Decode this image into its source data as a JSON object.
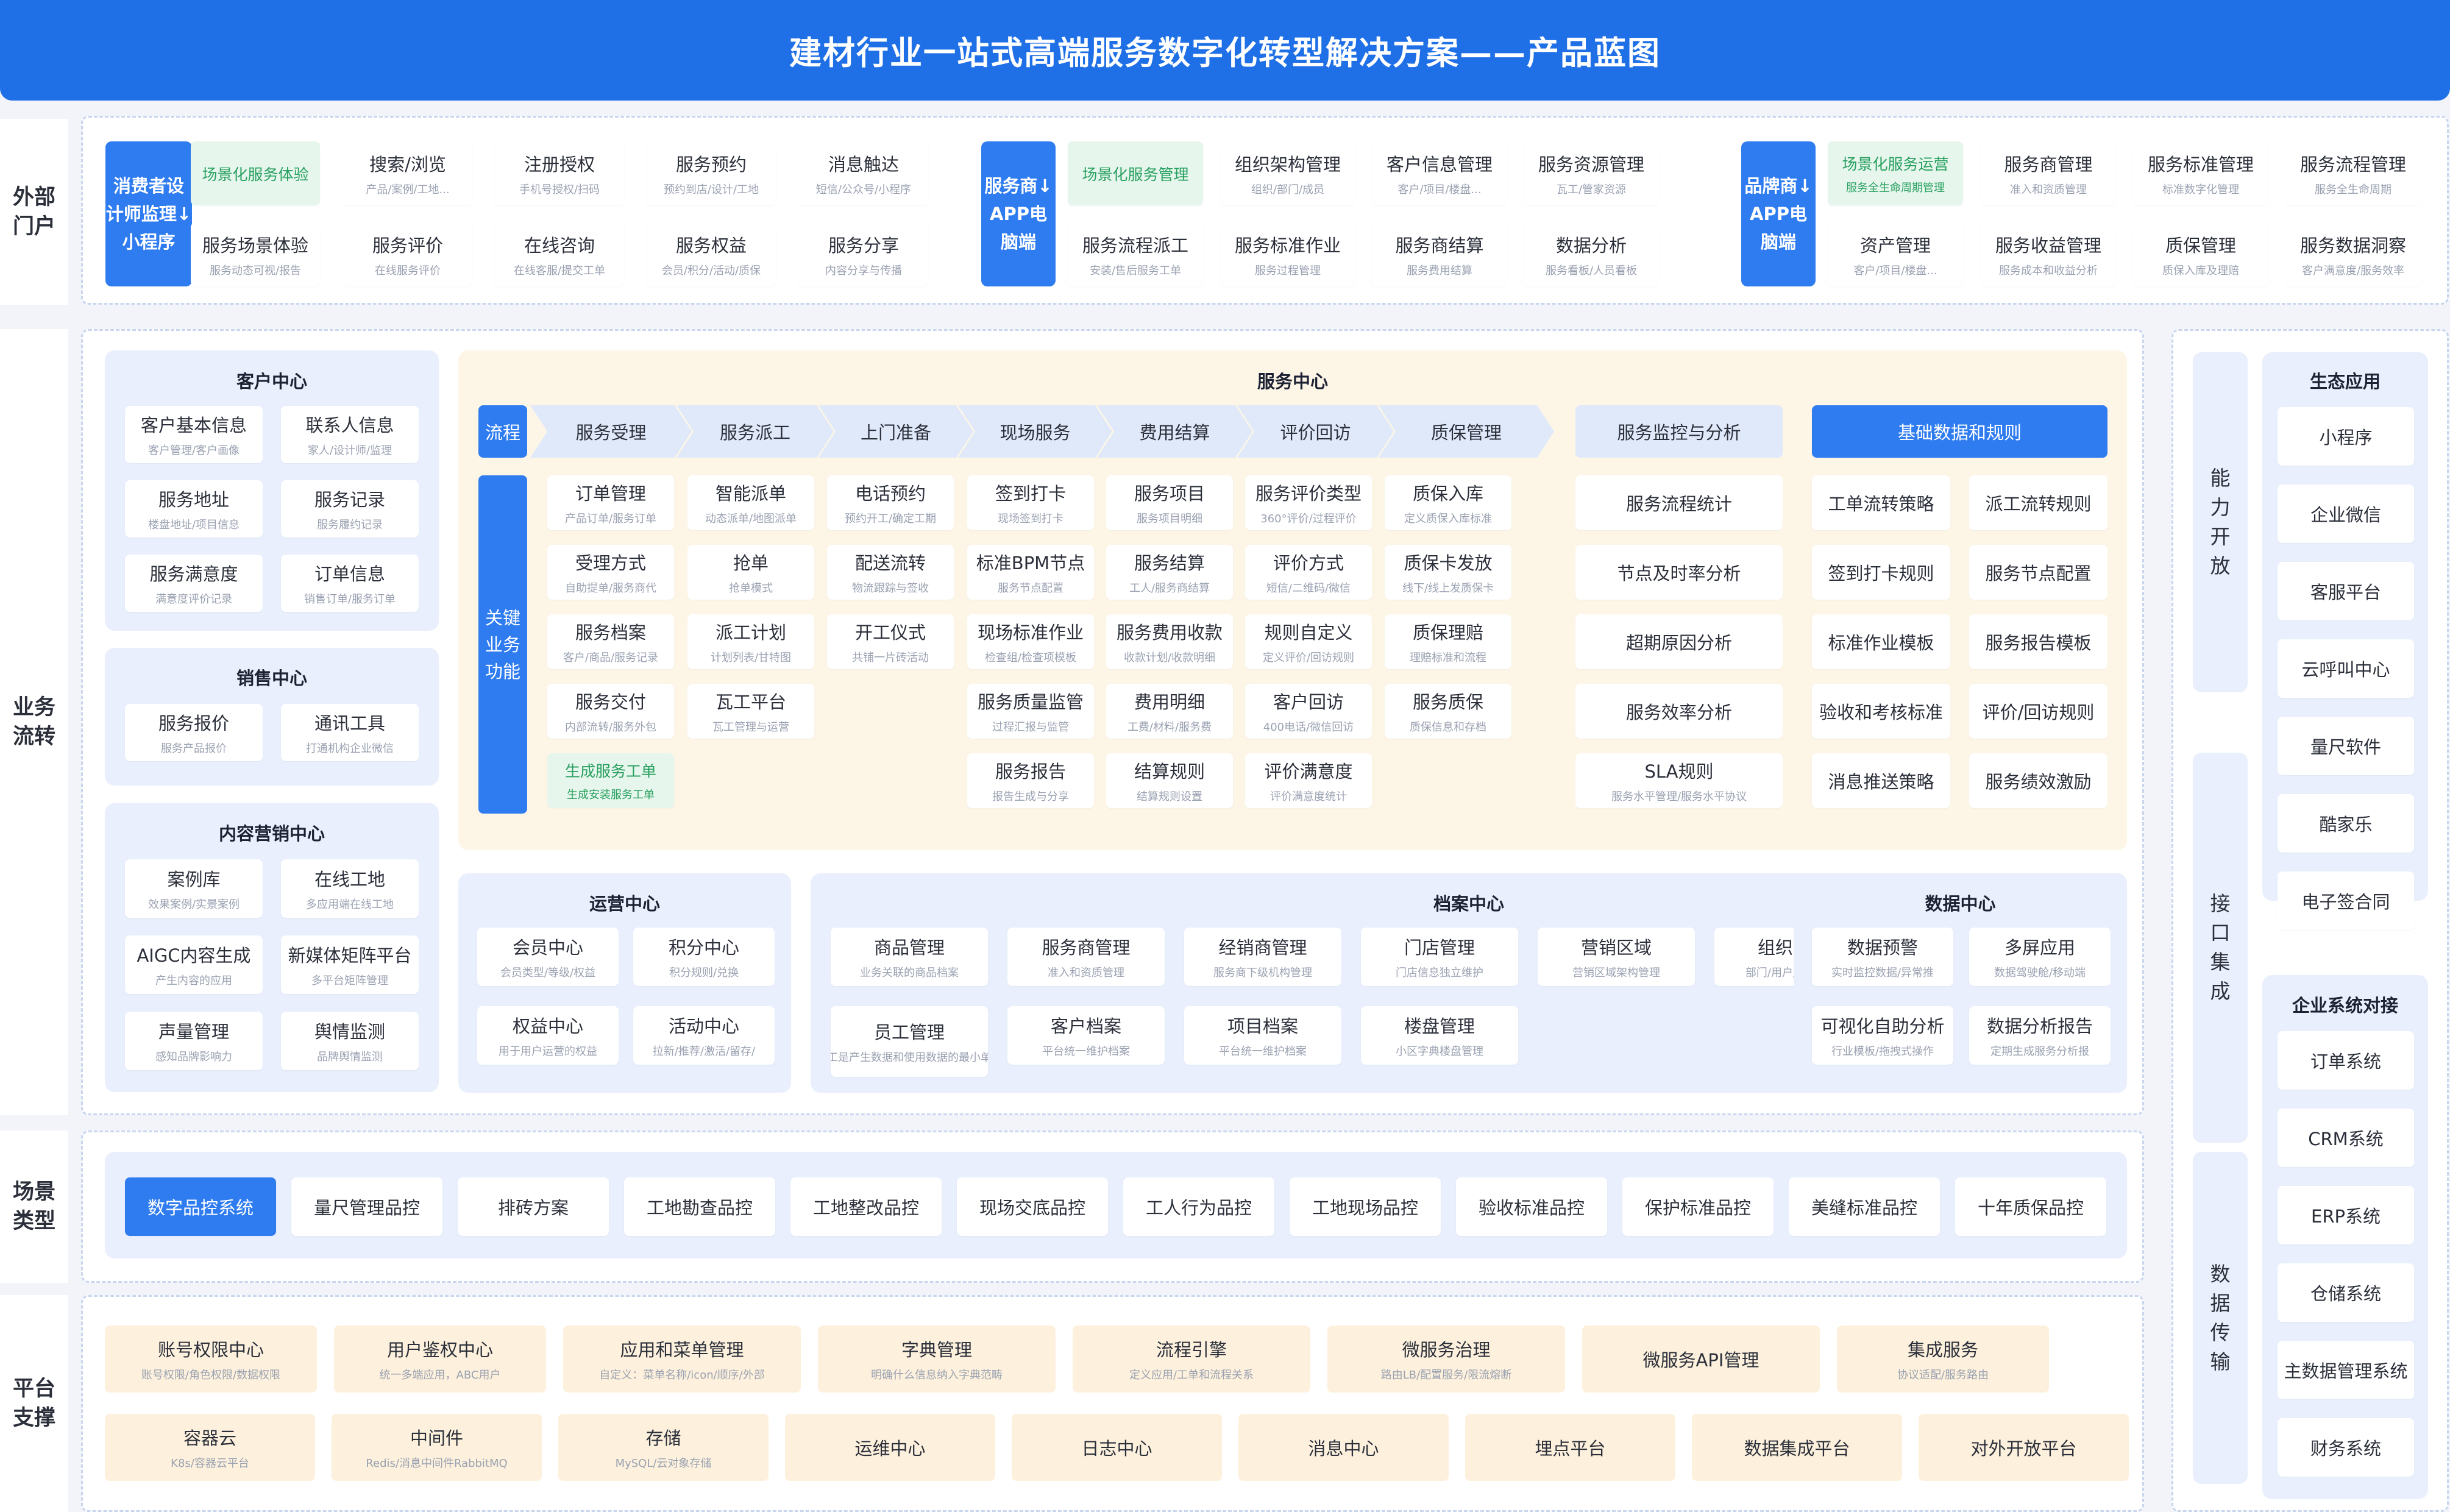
{
  "title": "建材行业一站式高端服务数字化转型解决方案——产品蓝图",
  "rows": {
    "external": "外部门户",
    "business": "业务流转",
    "scene": "场景类型",
    "platform": "平台支撑"
  },
  "portal": {
    "consumer_tag": "消费者设计师监理↓小程序",
    "consumer": [
      {
        "m": "场景化服务体验",
        "s": ""
      },
      {
        "m": "搜索/浏览",
        "s": "产品/案例/工地..."
      },
      {
        "m": "注册授权",
        "s": "手机号授权/扫码"
      },
      {
        "m": "服务预约",
        "s": "预约到店/设计/工地"
      },
      {
        "m": "消息触达",
        "s": "短信/公众号/小程序"
      },
      {
        "m": "服务场景体验",
        "s": "服务动态可视/报告"
      },
      {
        "m": "服务评价",
        "s": "在线服务评价"
      },
      {
        "m": "在线咨询",
        "s": "在线客服/提交工单"
      },
      {
        "m": "服务权益",
        "s": "会员/积分/活动/质保"
      },
      {
        "m": "服务分享",
        "s": "内容分享与传播"
      }
    ],
    "provider_tag": "服务商↓APP电脑端",
    "provider": [
      {
        "m": "场景化服务管理",
        "s": ""
      },
      {
        "m": "组织架构管理",
        "s": "组织/部门/成员"
      },
      {
        "m": "客户信息管理",
        "s": "客户/项目/楼盘..."
      },
      {
        "m": "服务资源管理",
        "s": "瓦工/管家资源"
      },
      {
        "m": "服务流程派工",
        "s": "安装/售后服务工单"
      },
      {
        "m": "服务标准作业",
        "s": "服务过程管理"
      },
      {
        "m": "服务商结算",
        "s": "服务费用结算"
      },
      {
        "m": "数据分析",
        "s": "服务看板/人员看板"
      }
    ],
    "brand_tag": "品牌商↓APP电脑端",
    "brand": [
      {
        "m": "场景化服务运营",
        "s": "服务全生命周期管理"
      },
      {
        "m": "服务商管理",
        "s": "准入和资质管理"
      },
      {
        "m": "服务标准管理",
        "s": "标准数字化管理"
      },
      {
        "m": "服务流程管理",
        "s": "服务全生命周期"
      },
      {
        "m": "资产管理",
        "s": "客户/项目/楼盘..."
      },
      {
        "m": "服务收益管理",
        "s": "服务成本和收益分析"
      },
      {
        "m": "质保管理",
        "s": "质保入库及理赔"
      },
      {
        "m": "服务数据洞察",
        "s": "客户满意度/服务效率"
      }
    ]
  },
  "customer_center": {
    "title": "客户中心",
    "items": [
      {
        "m": "客户基本信息",
        "s": "客户管理/客户画像"
      },
      {
        "m": "联系人信息",
        "s": "家人/设计师/监理"
      },
      {
        "m": "服务地址",
        "s": "楼盘地址/项目信息"
      },
      {
        "m": "服务记录",
        "s": "服务履约记录"
      },
      {
        "m": "服务满意度",
        "s": "满意度评价记录"
      },
      {
        "m": "订单信息",
        "s": "销售订单/服务订单"
      }
    ]
  },
  "sales_center": {
    "title": "销售中心",
    "items": [
      {
        "m": "服务报价",
        "s": "服务产品报价"
      },
      {
        "m": "通讯工具",
        "s": "打通机构企业微信"
      }
    ]
  },
  "content_center": {
    "title": "内容营销中心",
    "items": [
      {
        "m": "案例库",
        "s": "效果案例/实景案例"
      },
      {
        "m": "在线工地",
        "s": "多应用端在线工地"
      },
      {
        "m": "AIGC内容生成",
        "s": "产生内容的应用"
      },
      {
        "m": "新媒体矩阵平台",
        "s": "多平台矩阵管理"
      },
      {
        "m": "声量管理",
        "s": "感知品牌影响力"
      },
      {
        "m": "舆情监测",
        "s": "品牌舆情监测"
      }
    ]
  },
  "service_center": {
    "title": "服务中心",
    "flow_label": "流程",
    "key_label": "关键业务功能",
    "steps": [
      "服务受理",
      "服务派工",
      "上门准备",
      "现场服务",
      "费用结算",
      "评价回访",
      "质保管理"
    ],
    "columns": [
      [
        {
          "m": "订单管理",
          "s": "产品订单/服务订单"
        },
        {
          "m": "受理方式",
          "s": "自助提单/服务商代"
        },
        {
          "m": "服务档案",
          "s": "客户/商品/服务记录"
        },
        {
          "m": "服务交付",
          "s": "内部流转/服务外包"
        },
        {
          "m": "生成服务工单",
          "s": "生成安装服务工单"
        }
      ],
      [
        {
          "m": "智能派单",
          "s": "动态派单/地图派单"
        },
        {
          "m": "抢单",
          "s": "抢单模式"
        },
        {
          "m": "派工计划",
          "s": "计划列表/甘特图"
        },
        {
          "m": "瓦工平台",
          "s": "瓦工管理与运营"
        }
      ],
      [
        {
          "m": "电话预约",
          "s": "预约开工/确定工期"
        },
        {
          "m": "配送流转",
          "s": "物流跟踪与签收"
        },
        {
          "m": "开工仪式",
          "s": "共铺一片砖活动"
        }
      ],
      [
        {
          "m": "签到打卡",
          "s": "现场签到打卡"
        },
        {
          "m": "标准BPM节点",
          "s": "服务节点配置"
        },
        {
          "m": "现场标准作业",
          "s": "检查组/检查项模板"
        },
        {
          "m": "服务质量监管",
          "s": "过程汇报与监管"
        },
        {
          "m": "服务报告",
          "s": "报告生成与分享"
        }
      ],
      [
        {
          "m": "服务项目",
          "s": "服务项目明细"
        },
        {
          "m": "服务结算",
          "s": "工人/服务商结算"
        },
        {
          "m": "服务费用收款",
          "s": "收款计划/收款明细"
        },
        {
          "m": "费用明细",
          "s": "工费/材料/服务费"
        },
        {
          "m": "结算规则",
          "s": "结算规则设置"
        }
      ],
      [
        {
          "m": "服务评价类型",
          "s": "360°评价/过程评价"
        },
        {
          "m": "评价方式",
          "s": "短信/二维码/微信"
        },
        {
          "m": "规则自定义",
          "s": "定义评价/回访规则"
        },
        {
          "m": "客户回访",
          "s": "400电话/微信回访"
        },
        {
          "m": "评价满意度",
          "s": "评价满意度统计"
        }
      ],
      [
        {
          "m": "质保入库",
          "s": "定义质保入库标准"
        },
        {
          "m": "质保卡发放",
          "s": "线下/线上发质保卡"
        },
        {
          "m": "质保理赔",
          "s": "理赔标准和流程"
        },
        {
          "m": "服务质保",
          "s": "质保信息和存档"
        }
      ]
    ],
    "monitor_title": "服务监控与分析",
    "monitor": [
      {
        "m": "服务流程统计",
        "s": ""
      },
      {
        "m": "节点及时率分析",
        "s": ""
      },
      {
        "m": "超期原因分析",
        "s": ""
      },
      {
        "m": "服务效率分析",
        "s": ""
      },
      {
        "m": "SLA规则",
        "s": "服务水平管理/服务水平协议"
      }
    ],
    "base_title": "基础数据和规则",
    "base": [
      "工单流转策略",
      "派工流转规则",
      "签到打卡规则",
      "服务节点配置",
      "标准作业模板",
      "服务报告模板",
      "验收和考核标准",
      "评价/回访规则",
      "消息推送策略",
      "服务绩效激励"
    ]
  },
  "ops_center": {
    "title": "运营中心",
    "items": [
      {
        "m": "会员中心",
        "s": "会员类型/等级/权益"
      },
      {
        "m": "积分中心",
        "s": "积分规则/兑换"
      },
      {
        "m": "权益中心",
        "s": "用于用户运营的权益"
      },
      {
        "m": "活动中心",
        "s": "拉新/推荐/激活/留存/"
      }
    ]
  },
  "archive_center": {
    "title": "档案中心",
    "items": [
      {
        "m": "商品管理",
        "s": "业务关联的商品档案"
      },
      {
        "m": "服务商管理",
        "s": "准入和资质管理"
      },
      {
        "m": "经销商管理",
        "s": "服务商下级机构管理"
      },
      {
        "m": "门店管理",
        "s": "门店信息独立维护"
      },
      {
        "m": "营销区域",
        "s": "营销区域架构管理"
      },
      {
        "m": "组织架构",
        "s": "部门/用户/角色管理"
      },
      {
        "m": "员工管理",
        "s": "员工是产生数据和使用数据的最小单位"
      },
      {
        "m": "客户档案",
        "s": "平台统一维护档案"
      },
      {
        "m": "项目档案",
        "s": "平台统一维护档案"
      },
      {
        "m": "楼盘管理",
        "s": "小区字典楼盘管理"
      }
    ]
  },
  "data_center": {
    "title": "数据中心",
    "items": [
      {
        "m": "数据预警",
        "s": "实时监控数据/异常推"
      },
      {
        "m": "多屏应用",
        "s": "数据驾驶舱/移动端"
      },
      {
        "m": "可视化自助分析",
        "s": "行业模板/拖拽式操作"
      },
      {
        "m": "数据分析报告",
        "s": "定期生成服务分析报"
      }
    ]
  },
  "scenes": [
    "数字品控系统",
    "量尺管理品控",
    "排砖方案",
    "工地勘查品控",
    "工地整改品控",
    "现场交底品控",
    "工人行为品控",
    "工地现场品控",
    "验收标准品控",
    "保护标准品控",
    "美缝标准品控",
    "十年质保品控"
  ],
  "platform": {
    "row1": [
      {
        "m": "账号权限中心",
        "s": "账号权限/角色权限/数据权限"
      },
      {
        "m": "用户鉴权中心",
        "s": "统一多端应用，ABC用户"
      },
      {
        "m": "应用和菜单管理",
        "s": "自定义：菜单名称/icon/顺序/外部"
      },
      {
        "m": "字典管理",
        "s": "明确什么信息纳入字典范畴"
      },
      {
        "m": "流程引擎",
        "s": "定义应用/工单和流程关系"
      },
      {
        "m": "微服务治理",
        "s": "路由LB/配置服务/限流熔断"
      },
      {
        "m": "微服务API管理",
        "s": ""
      },
      {
        "m": "集成服务",
        "s": "协议适配/服务路由"
      }
    ],
    "row2": [
      {
        "m": "容器云",
        "s": "K8s/容器云平台"
      },
      {
        "m": "中间件",
        "s": "Redis/消息中间件RabbitMQ"
      },
      {
        "m": "存储",
        "s": "MySQL/云对象存储"
      },
      {
        "m": "运维中心",
        "s": ""
      },
      {
        "m": "日志中心",
        "s": ""
      },
      {
        "m": "消息中心",
        "s": ""
      },
      {
        "m": "埋点平台",
        "s": ""
      },
      {
        "m": "数据集成平台",
        "s": ""
      },
      {
        "m": "对外开放平台",
        "s": ""
      }
    ]
  },
  "right": {
    "open_label": "能力开放",
    "api_label": "接口集成",
    "data_label": "数据传输",
    "eco_title": "生态应用",
    "eco": [
      "小程序",
      "企业微信",
      "客服平台",
      "云呼叫中心",
      "量尺软件",
      "酷家乐",
      "电子签合同"
    ],
    "ent_title": "企业系统对接",
    "ent": [
      "订单系统",
      "CRM系统",
      "ERP系统",
      "仓储系统",
      "主数据管理系统",
      "财务系统"
    ]
  }
}
